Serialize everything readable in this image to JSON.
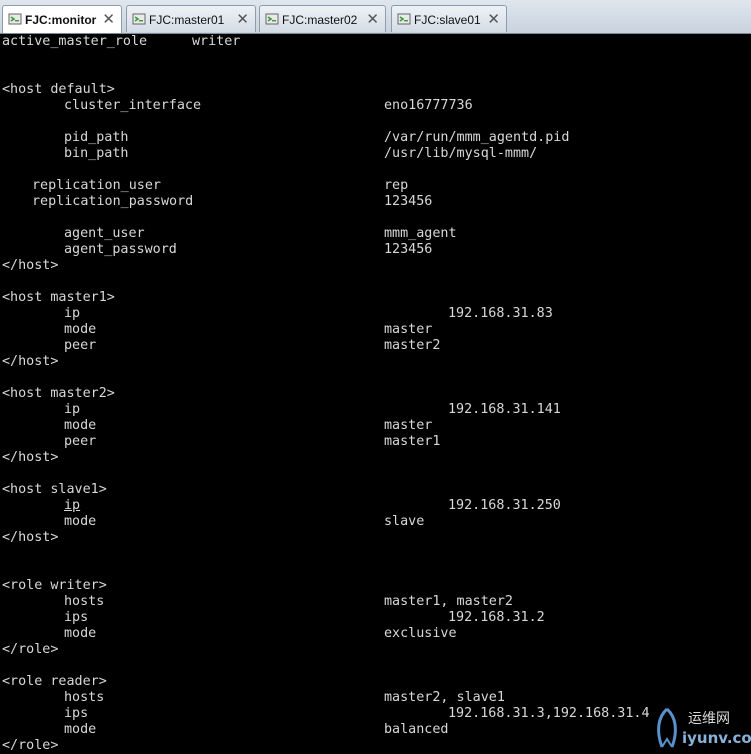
{
  "tabs": [
    {
      "label": "FJC:monitor",
      "active": true
    },
    {
      "label": "FJC:master01",
      "active": false
    },
    {
      "label": "FJC:master02",
      "active": false
    },
    {
      "label": "FJC:slave01",
      "active": false
    }
  ],
  "close_glyph": "✕",
  "lines": [
    {
      "key": "active_master_role",
      "val": "writer"
    },
    {
      "key": "<host default>"
    },
    {
      "key": "cluster_interface",
      "val": "eno16777736"
    },
    {
      "key": "pid_path",
      "val": "/var/run/mmm_agentd.pid"
    },
    {
      "key": "bin_path",
      "val": "/usr/lib/mysql-mmm/"
    },
    {
      "key": "replication_user",
      "val": "rep"
    },
    {
      "key": "replication_password",
      "val": "123456"
    },
    {
      "key": "agent_user",
      "val": "mmm_agent"
    },
    {
      "key": "agent_password",
      "val": "123456"
    },
    {
      "key": "</host>"
    },
    {
      "key": "<host master1>"
    },
    {
      "key": "ip",
      "val": "192.168.31.83"
    },
    {
      "key": "mode",
      "val": "master"
    },
    {
      "key": "peer",
      "val": "master2"
    },
    {
      "key": "</host>"
    },
    {
      "key": "<host master2>"
    },
    {
      "key": "ip",
      "val": "192.168.31.141"
    },
    {
      "key": "mode",
      "val": "master"
    },
    {
      "key": "peer",
      "val": "master1"
    },
    {
      "key": "</host>"
    },
    {
      "key": "<host slave1>"
    },
    {
      "key": "ip",
      "val": "192.168.31.250"
    },
    {
      "key": "mode",
      "val": "slave"
    },
    {
      "key": "</host>"
    },
    {
      "key": "<role writer>"
    },
    {
      "key": "hosts",
      "val": "master1, master2"
    },
    {
      "key": "ips",
      "val": "192.168.31.2"
    },
    {
      "key": "mode",
      "val": "exclusive"
    },
    {
      "key": "</role>"
    },
    {
      "key": "<role reader>"
    },
    {
      "key": "hosts",
      "val": "master2, slave1"
    },
    {
      "key": "ips",
      "val": "192.168.31.3,192.168.31.4"
    },
    {
      "key": "mode",
      "val": "balanced"
    },
    {
      "key": "</role>"
    }
  ],
  "watermark": {
    "line1": "运维网",
    "line2": "iyunv.com"
  },
  "colors": {
    "terminal_bg": "#000000",
    "terminal_fg": "#d8d8d8",
    "tab_icon": "#3a9a3a"
  }
}
